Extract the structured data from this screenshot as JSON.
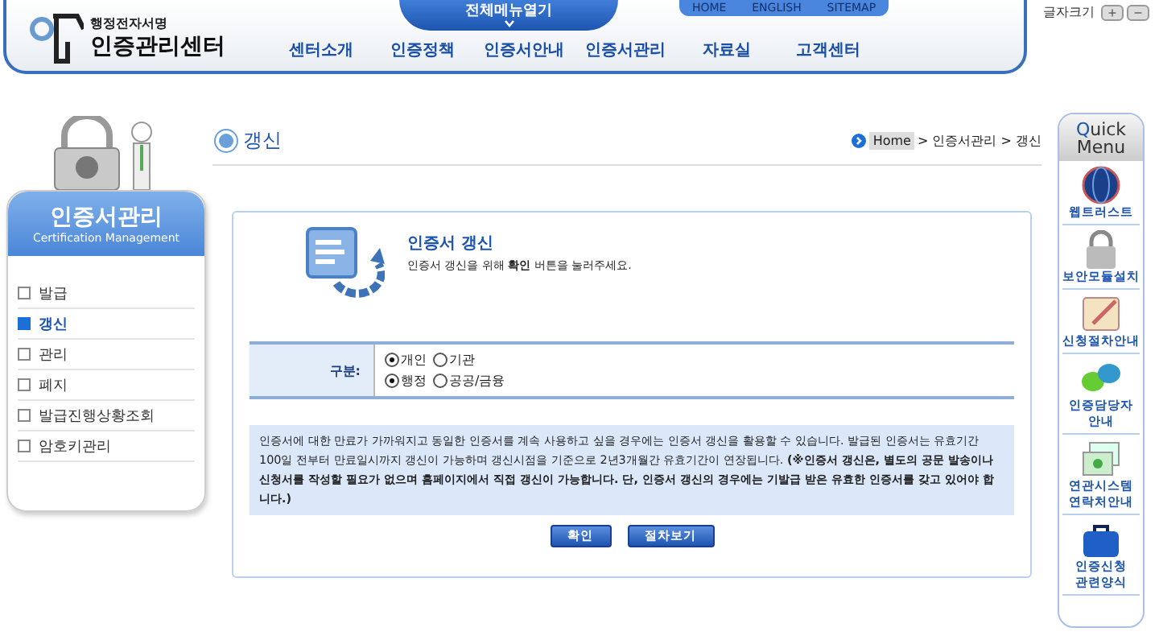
{
  "header": {
    "logo_small": "행정전자서명",
    "logo_large": "인증관리센터",
    "all_menu": "전체메뉴열기",
    "util_links": [
      "HOME",
      "ENGLISH",
      "SITEMAP"
    ],
    "font_size_label": "글자크기",
    "font_buttons": [
      "+",
      "−"
    ],
    "nav": [
      "센터소개",
      "인증정책",
      "인증서안내",
      "인증서관리",
      "자료실",
      "고객센터"
    ]
  },
  "sidebar": {
    "title": "인증서관리",
    "subtitle": "Certification Management",
    "items": [
      {
        "label": "발급",
        "selected": false
      },
      {
        "label": "갱신",
        "selected": true
      },
      {
        "label": "관리",
        "selected": false
      },
      {
        "label": "폐지",
        "selected": false
      },
      {
        "label": "발급진행상황조회",
        "selected": false
      },
      {
        "label": "암호키관리",
        "selected": false
      }
    ]
  },
  "page_title": "갱신",
  "breadcrumb": [
    "Home",
    "> 인증서관리 > 갱신"
  ],
  "panel": {
    "title": "인증서 갱신",
    "subtitle": "인증서 갱신을 위해 **확인** 버튼을 눌러주세요.",
    "form": {
      "label": "구분:",
      "groups": [
        [
          {
            "label": "개인",
            "selected": true
          },
          {
            "label": "기관",
            "selected": false
          }
        ],
        [
          {
            "label": "행정",
            "selected": true
          },
          {
            "label": "공공/금융",
            "selected": false
          }
        ]
      ]
    },
    "notice": "인증서에 대한 만료가 가까워지고 동일한 인증서를 계속 사용하고 싶을 경우에는 인증서 갱신을 활용할 수 있습니다. 발급된 인증서는 유효기간 100일 전부터 만료일시까지 갱신이 가능하며 갱신시점을 기준으로 2년3개월간 유효기간이 연장됩니다. **(※인증서 갱신은, 별도의 공문 발송이나 신청서를 작성할 필요가 없으며 홈페이지에서 직접 갱신이 가능합니다. 단, 인증서 갱신의 경우에는 기발급 받은 유효한 인증서를 갖고 있어야 합니다.)**",
    "buttons": [
      "확인",
      "절차보기"
    ]
  },
  "quick_menu": {
    "title_first": "Q",
    "title_rest": "uick",
    "title_line2": "Menu",
    "items": [
      {
        "kind": "globe",
        "label": "웹트러스트"
      },
      {
        "kind": "lock",
        "label": "보안모듈설치"
      },
      {
        "kind": "note",
        "label": "신청절차안내"
      },
      {
        "kind": "chat",
        "label": "인증담당자 안내"
      },
      {
        "kind": "mail",
        "label": "연관시스템 연락처안내"
      },
      {
        "kind": "bag",
        "label": "인증신청 관련양식"
      }
    ]
  }
}
